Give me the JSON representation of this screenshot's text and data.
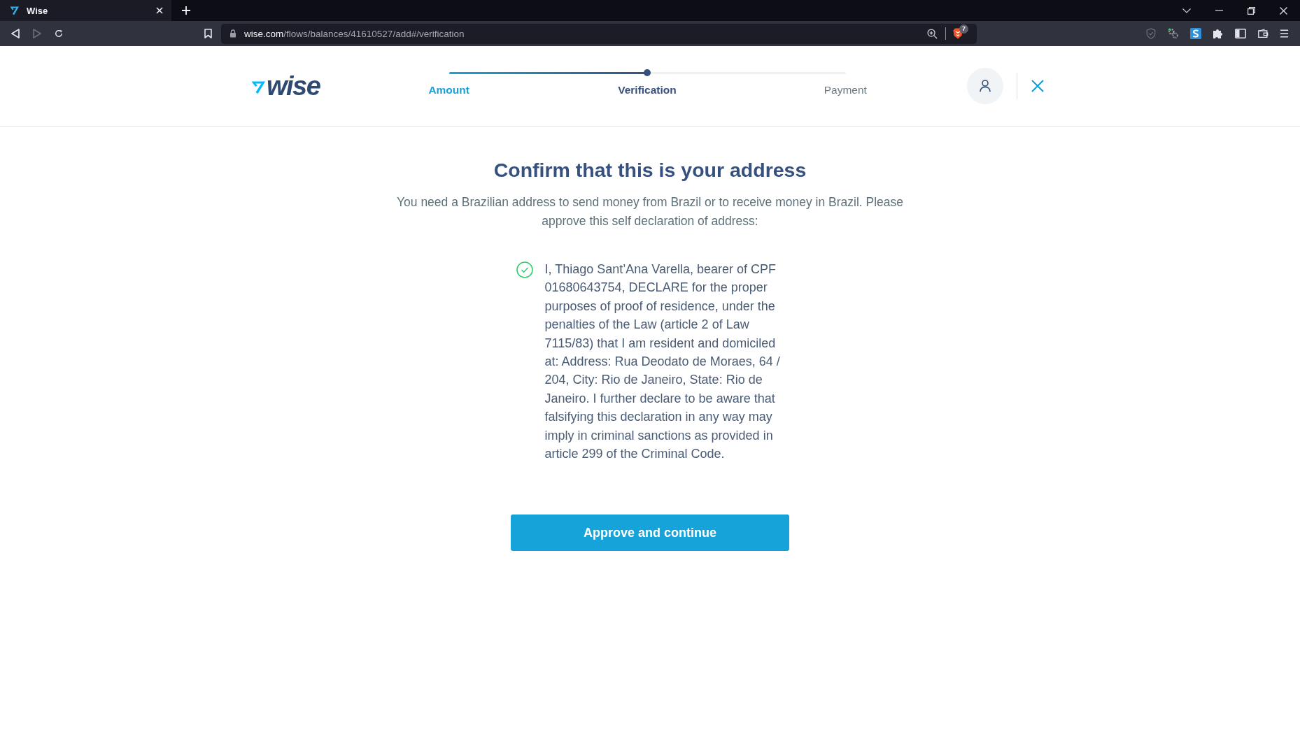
{
  "browser": {
    "tab": {
      "title": "Wise",
      "selected": true
    },
    "forward": {
      "disabled": true
    },
    "address_bar": {
      "domain": "wise.com",
      "path": "/flows/balances/41610527/add#/verification"
    },
    "shields_badge": "7"
  },
  "header": {
    "logo_text": "wise",
    "progress": {
      "level": 0.5
    },
    "steps": [
      {
        "label": "Amount",
        "completed": true,
        "selected": false
      },
      {
        "label": "Verification",
        "completed": false,
        "selected": true
      },
      {
        "label": "Payment",
        "completed": false,
        "selected": false
      }
    ]
  },
  "content": {
    "title": "Confirm that this is your address",
    "intro": "You need a Brazilian address to send money from Brazil or to receive money in Brazil. Please approve this self declaration of address:",
    "declaration": {
      "checked": true,
      "text": "I, Thiago Sant’Ana Varella, bearer of CPF 01680643754, DECLARE for the proper purposes of proof of residence, under the penalties of the Law (article 2 of Law 7115/83) that I am resident and domiciled at: Address: Rua Deodato de Moraes, 64 / 204, City: Rio de Janeiro, State: Rio de Janeiro. I further declare to be aware that falsifying this declaration in any way may imply in criminal sanctions as provided in article 299 of the Criminal Code."
    },
    "approve_button": "Approve and continue"
  }
}
